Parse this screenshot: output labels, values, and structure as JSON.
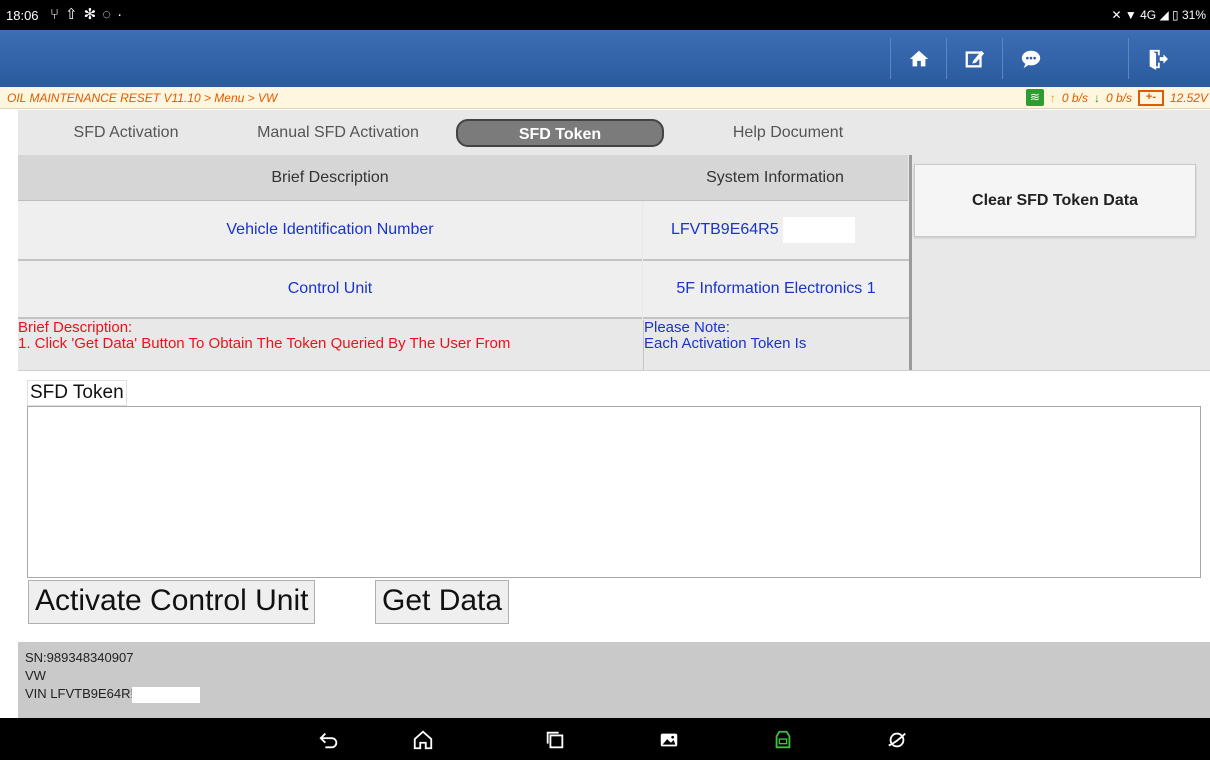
{
  "status_bar": {
    "time": "18:06",
    "left_icons": [
      "usb-icon",
      "upload-icon",
      "bluetooth-icon",
      "chat-icon",
      "dot-icon"
    ],
    "right_text": "4G",
    "battery": "31%"
  },
  "header": {
    "buttons": [
      {
        "name": "home-button",
        "icon": "home-icon"
      },
      {
        "name": "report-button",
        "icon": "edit-icon"
      },
      {
        "name": "feedback-button",
        "icon": "chat-icon"
      },
      {
        "name": "exit-button",
        "icon": "exit-icon"
      }
    ]
  },
  "breadcrumb": {
    "text": "OIL MAINTENANCE RESET V11.10 > Menu > VW"
  },
  "connection": {
    "upload_rate": "0 b/s",
    "download_rate": "0 b/s",
    "battery_voltage": "12.52V",
    "battery_icon_text": "+-"
  },
  "tabs": [
    {
      "label": "SFD Activation",
      "active": false
    },
    {
      "label": "Manual SFD Activation",
      "active": false
    },
    {
      "label": "SFD Token",
      "active": true
    },
    {
      "label": "Help Document",
      "active": false
    }
  ],
  "table": {
    "headers": [
      "Brief Description",
      "System Information"
    ],
    "rows": [
      {
        "label": "Vehicle Identification Number",
        "value": "LFVTB9E64R5"
      },
      {
        "label": "Control Unit",
        "value": "5F Information Electronics 1"
      }
    ]
  },
  "descriptions": {
    "left_title": "Brief Description:",
    "left_line1": "1. Click 'Get Data' Button To Obtain The Token Queried By The User From",
    "right_title": "Please Note:",
    "right_line1": "Each Activation Token Is"
  },
  "side": {
    "clear_button": "Clear SFD Token Data"
  },
  "token": {
    "label": "SFD Token",
    "value": ""
  },
  "actions": {
    "activate": "Activate Control Unit",
    "get_data": "Get Data"
  },
  "footer": {
    "sn": "SN:989348340907",
    "make": "VW",
    "vin": "VIN LFVTB9E64R!"
  },
  "nav_bar": [
    "back-icon",
    "home-icon",
    "recents-icon",
    "gallery-icon",
    "vci-icon",
    "browser-icon"
  ]
}
